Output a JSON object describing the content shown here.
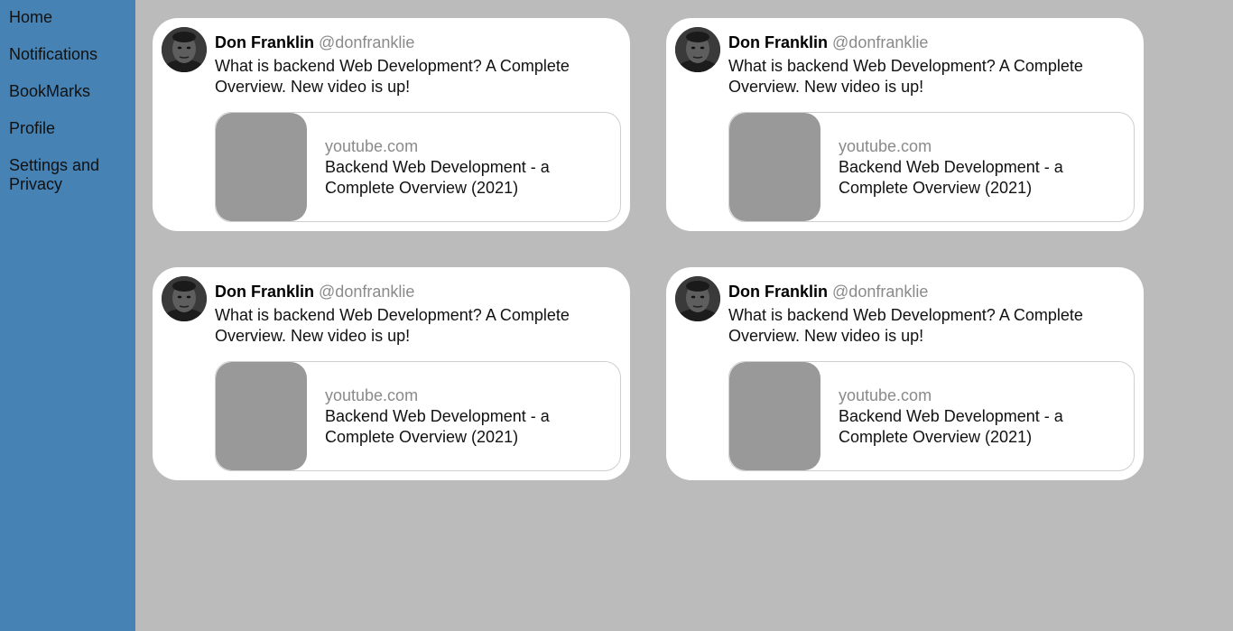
{
  "sidebar": {
    "items": [
      {
        "label": "Home"
      },
      {
        "label": "Notifications"
      },
      {
        "label": "BookMarks"
      },
      {
        "label": "Profile"
      },
      {
        "label": "Settings and Privacy"
      }
    ]
  },
  "tweets": [
    {
      "name": "Don Franklin",
      "handle": "@donfranklie",
      "text": "What is backend Web Development? A Complete Overview. New video is up!",
      "link": {
        "domain": "youtube.com",
        "title": "Backend Web Development - a Complete Overview (2021)"
      }
    },
    {
      "name": "Don Franklin",
      "handle": "@donfranklie",
      "text": "What is backend Web Development? A Complete Overview. New video is up!",
      "link": {
        "domain": "youtube.com",
        "title": "Backend Web Development - a Complete Overview (2021)"
      }
    },
    {
      "name": "Don Franklin",
      "handle": "@donfranklie",
      "text": "What is backend Web Development? A Complete Overview. New video is up!",
      "link": {
        "domain": "youtube.com",
        "title": "Backend Web Development - a Complete Overview (2021)"
      }
    },
    {
      "name": "Don Franklin",
      "handle": "@donfranklie",
      "text": "What is backend Web Development? A Complete Overview. New video is up!",
      "link": {
        "domain": "youtube.com",
        "title": "Backend Web Development - a Complete Overview (2021)"
      }
    }
  ],
  "colors": {
    "sidebar": "#4682b4",
    "background": "#bbbbbb",
    "card": "#ffffff",
    "thumbnail": "#999999",
    "muted_text": "#8a8a8a"
  }
}
